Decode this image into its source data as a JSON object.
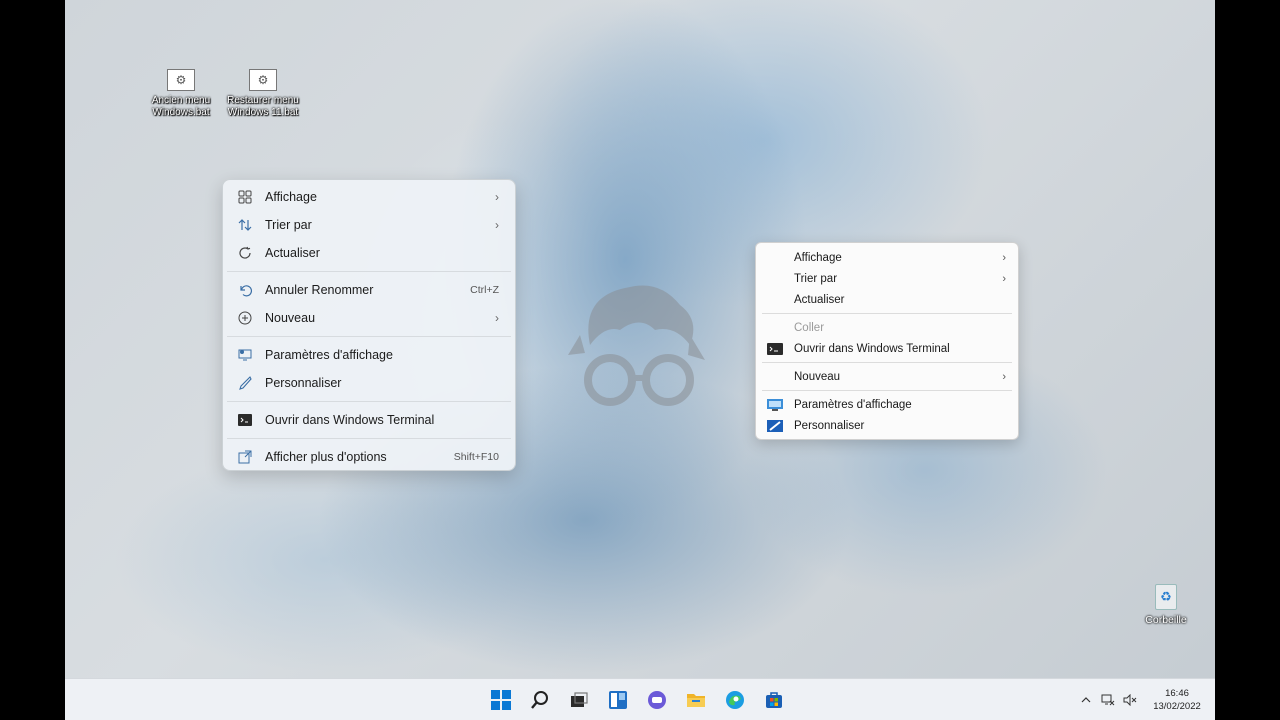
{
  "desktop": {
    "icons": [
      {
        "label": "Ancien menu Windows.bat",
        "line1": "Ancien menu",
        "line2": "Windows.bat"
      },
      {
        "label": "Restaurer menu Windows 11.bat",
        "line1": "Restaurer menu",
        "line2": "Windows 11.bat"
      }
    ],
    "recycle_bin": "Corbeille"
  },
  "menu_win11": {
    "items": [
      {
        "label": "Affichage",
        "icon": "view-grid-icon",
        "submenu": true
      },
      {
        "label": "Trier par",
        "icon": "sort-icon",
        "submenu": true
      },
      {
        "label": "Actualiser",
        "icon": "refresh-icon"
      },
      {
        "label": "Annuler Renommer",
        "icon": "undo-icon",
        "shortcut": "Ctrl+Z"
      },
      {
        "label": "Nouveau",
        "icon": "new-plus-icon",
        "submenu": true
      },
      {
        "label": "Paramètres d'affichage",
        "icon": "display-settings-icon"
      },
      {
        "label": "Personnaliser",
        "icon": "brush-icon"
      },
      {
        "label": "Ouvrir dans Windows Terminal",
        "icon": "terminal-icon"
      },
      {
        "label": "Afficher plus d'options",
        "icon": "more-options-icon",
        "shortcut": "Shift+F10"
      }
    ]
  },
  "menu_classic": {
    "items": [
      {
        "label": "Affichage",
        "submenu": true
      },
      {
        "label": "Trier par",
        "submenu": true
      },
      {
        "label": "Actualiser"
      },
      {
        "label": "Coller",
        "disabled": true
      },
      {
        "label": "Ouvrir dans Windows Terminal",
        "icon": "terminal-icon"
      },
      {
        "label": "Nouveau",
        "submenu": true
      },
      {
        "label": "Paramètres d'affichage",
        "icon": "display-settings-icon"
      },
      {
        "label": "Personnaliser",
        "icon": "personalize-icon"
      }
    ]
  },
  "taskbar": {
    "apps": [
      "start-icon",
      "search-icon",
      "task-view-icon",
      "widgets-icon",
      "chat-icon",
      "file-explorer-icon",
      "edge-icon",
      "store-icon"
    ],
    "clock": {
      "time": "16:46",
      "date": "13/02/2022"
    }
  },
  "colors": {
    "accent": "#0067c0",
    "taskbar_bg": "#eef1f5",
    "menu_bg": "#eef2f6"
  }
}
